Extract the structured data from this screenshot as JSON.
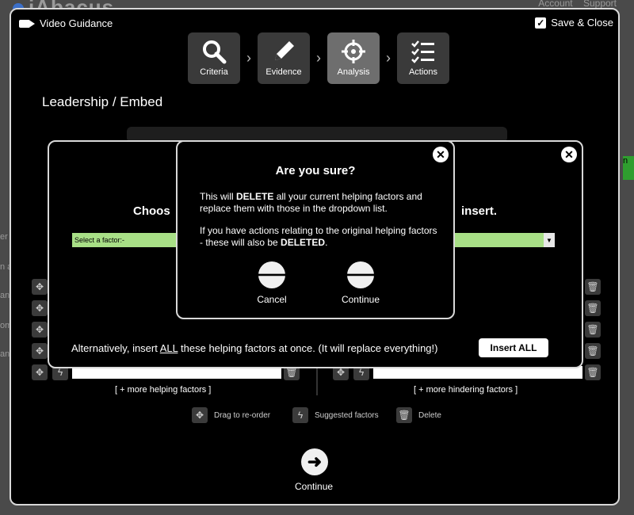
{
  "background": {
    "app_name": "iAbacus",
    "account_label": "Account",
    "support_label": "Support",
    "side_fragments": [
      "er",
      "n a",
      "and",
      "om",
      "and"
    ],
    "green_fragment": "n"
  },
  "header": {
    "video_guidance_label": "Video Guidance",
    "save_close_label": "Save & Close"
  },
  "steps": [
    {
      "label": "Criteria",
      "icon": "search-icon"
    },
    {
      "label": "Evidence",
      "icon": "pencil-icon"
    },
    {
      "label": "Analysis",
      "icon": "crosshair-icon",
      "active": true
    },
    {
      "label": "Actions",
      "icon": "checklist-icon"
    }
  ],
  "page_title": "Leadership / Embed",
  "lower": {
    "more_helping": "[ + more helping factors ]",
    "more_hindering": "[ + more hindering factors ]",
    "legend": {
      "drag": "Drag to re-order",
      "suggested": "Suggested factors",
      "delete": "Delete"
    },
    "continue_label": "Continue"
  },
  "modal_choose": {
    "heading_left": "Choos",
    "heading_right": "insert.",
    "select_placeholder": "Select a factor:-",
    "alternative_prefix": "Alternatively, insert ",
    "alternative_all": "ALL",
    "alternative_suffix": " these helping factors at once. (It will replace everything!)",
    "insert_all_label": "Insert ALL"
  },
  "modal_confirm": {
    "title": "Are you sure?",
    "p1_pre": "This will ",
    "p1_bold": "DELETE",
    "p1_post": " all your current helping factors and replace them with those in the dropdown list.",
    "p2_pre": "If you have actions relating to the original helping factors - these will also be ",
    "p2_bold": "DELETED",
    "p2_post": ".",
    "cancel_label": "Cancel",
    "continue_label": "Continue"
  }
}
